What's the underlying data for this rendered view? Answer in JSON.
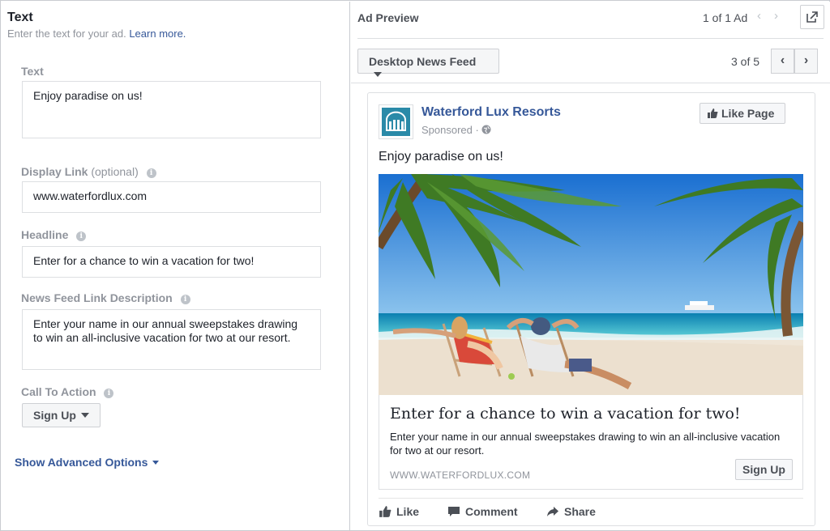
{
  "left_panel": {
    "title": "Text",
    "subtitle": "Enter the text for your ad.",
    "learn_more": "Learn more.",
    "fields": {
      "text": {
        "label": "Text",
        "value": "Enjoy paradise on us!"
      },
      "display_link": {
        "label": "Display Link",
        "optional": "(optional)",
        "value": "www.waterfordlux.com"
      },
      "headline": {
        "label": "Headline",
        "value": "Enter for a chance to win a vacation for two!"
      },
      "description": {
        "label": "News Feed Link Description",
        "value": "Enter your name in our annual sweepstakes drawing to win an all-inclusive vacation for two at our resort."
      },
      "cta": {
        "label": "Call To Action",
        "value": "Sign Up"
      }
    },
    "advanced": "Show Advanced Options"
  },
  "right_panel": {
    "title": "Ad Preview",
    "ad_count": "1 of 1 Ad",
    "placement": "Desktop News Feed",
    "page_count": "3 of 5"
  },
  "ad": {
    "page_name": "Waterford Lux Resorts",
    "sponsored": "Sponsored ·",
    "like_page": "Like Page",
    "post_text": "Enjoy paradise on us!",
    "headline": "Enter for a chance to win a vacation for two!",
    "description": "Enter your name in our annual sweepstakes drawing to win an all-inclusive vacation for two at our resort.",
    "url": "WWW.WATERFORDLUX.COM",
    "cta": "Sign Up",
    "actions": {
      "like": "Like",
      "comment": "Comment",
      "share": "Share"
    }
  },
  "colors": {
    "link": "#365899",
    "label": "#90949c",
    "text": "#1d2129",
    "border": "#dddfe2"
  },
  "icons": [
    "info-icon",
    "caret-down-icon",
    "external-link-icon",
    "chevron-left-icon",
    "chevron-right-icon",
    "thumbs-up-icon",
    "globe-icon",
    "comment-icon",
    "share-icon",
    "logo-icon"
  ]
}
